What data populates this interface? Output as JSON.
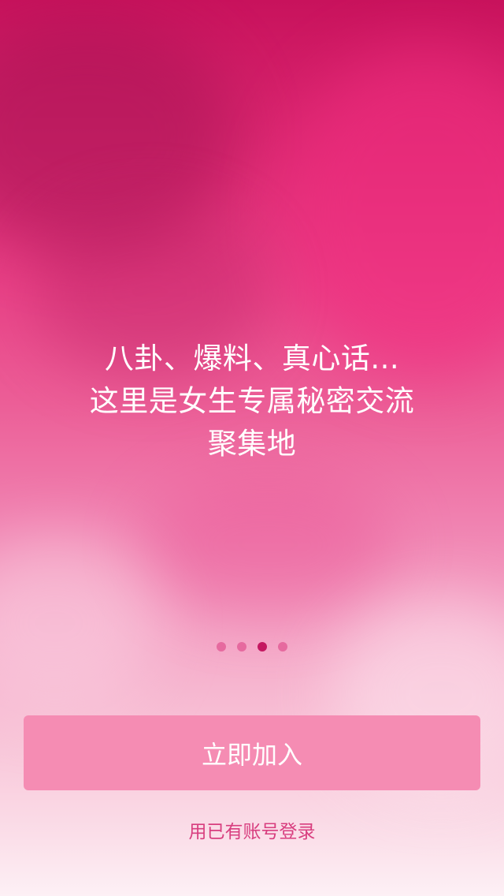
{
  "onboarding": {
    "headline_lines": [
      "八卦、爆料、真心话...",
      "这里是女生专属秘密交流",
      "聚集地"
    ],
    "pagination": {
      "total": 4,
      "active_index": 2
    }
  },
  "actions": {
    "join_label": "立即加入",
    "login_label": "用已有账号登录"
  },
  "colors": {
    "button": "#f58cb3",
    "active_dot": "#c41861",
    "inactive_dot": "#e66a9f",
    "login_link": "#d83e7f"
  }
}
